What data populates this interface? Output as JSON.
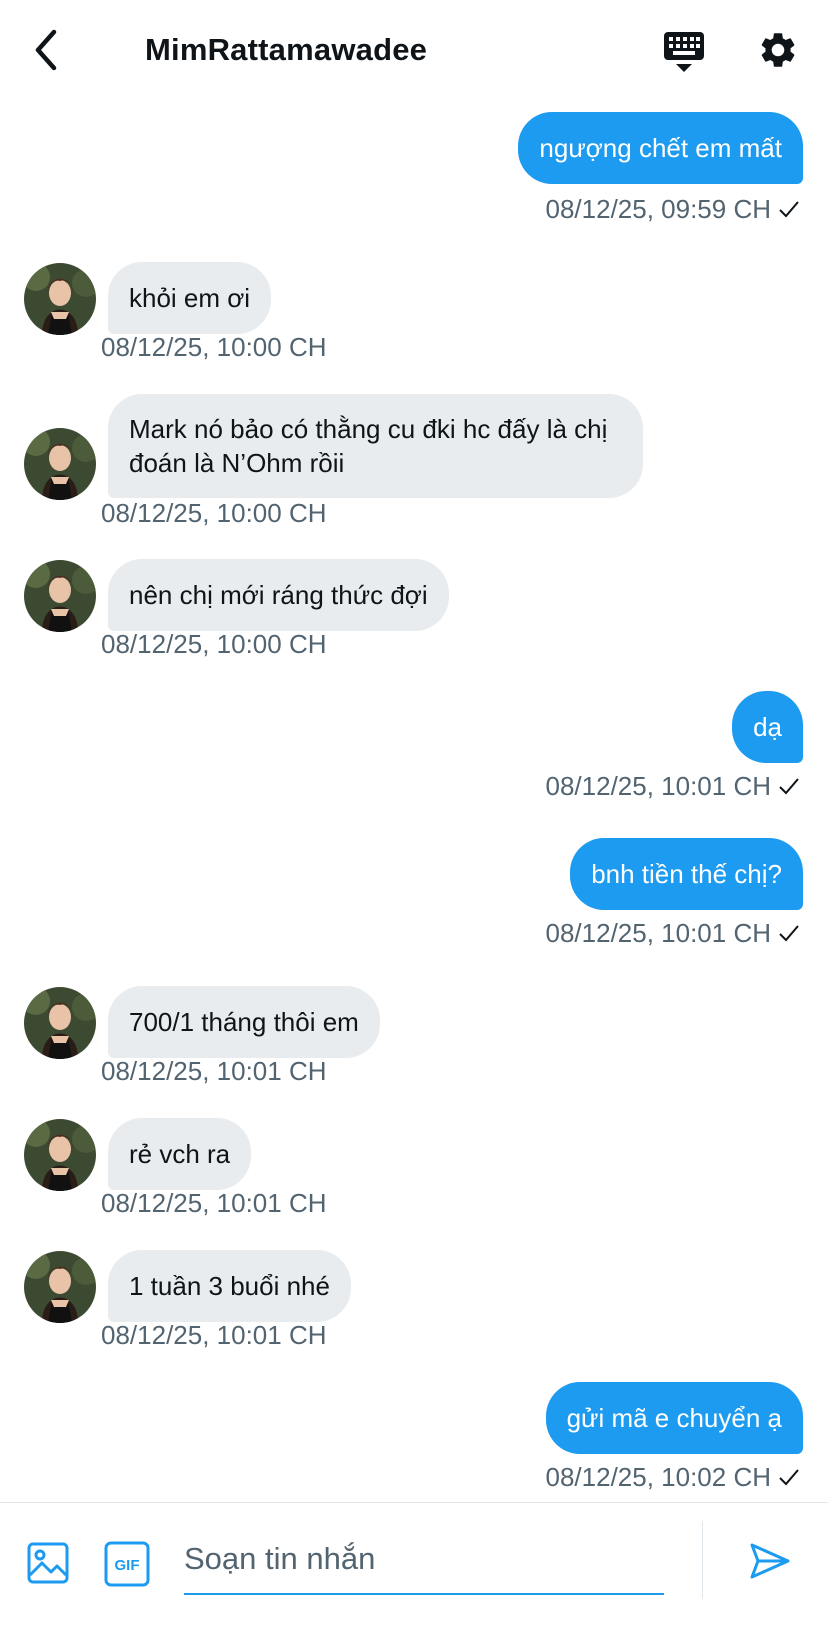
{
  "header": {
    "title": "MimRattamawadee",
    "icons": {
      "back": "back-arrow-icon",
      "keyboard": "keyboard-icon",
      "settings": "gear-icon"
    }
  },
  "messages": [
    {
      "direction": "out",
      "text": "ngượng chết em mất",
      "time": "08/12/25, 09:59 CH",
      "read": true
    },
    {
      "direction": "in",
      "text": "khỏi em ơi",
      "time": "08/12/25, 10:00 CH"
    },
    {
      "direction": "in",
      "text": "Mark nó bảo có thằng cu đki hc đấy là chị đoán là N’Ohm rồii",
      "time": "08/12/25, 10:00 CH"
    },
    {
      "direction": "in",
      "text": "nên chị mới ráng thức đợi",
      "time": "08/12/25, 10:00 CH"
    },
    {
      "direction": "out",
      "text": "dạ",
      "time": "08/12/25, 10:01 CH",
      "read": true
    },
    {
      "direction": "out",
      "text": "bnh tiền thế chị?",
      "time": "08/12/25, 10:01 CH",
      "read": true
    },
    {
      "direction": "in",
      "text": "700/1 tháng thôi em",
      "time": "08/12/25, 10:01 CH"
    },
    {
      "direction": "in",
      "text": "rẻ vch ra",
      "time": "08/12/25, 10:01 CH"
    },
    {
      "direction": "in",
      "text": "1 tuần 3 buổi nhé",
      "time": "08/12/25, 10:01 CH"
    },
    {
      "direction": "out",
      "text": "gửi mã e chuyển ạ",
      "time": "08/12/25, 10:02 CH",
      "read": true
    }
  ],
  "composer": {
    "placeholder": "Soạn tin nhắn",
    "value": "",
    "gif_label": "GIF",
    "icons": {
      "media": "image-icon",
      "gif": "gif-icon",
      "send": "send-icon"
    }
  },
  "colors": {
    "accent": "#1d9bf0",
    "incoming_bubble": "#e8ecef",
    "timestamp": "#536471",
    "text": "#0f1419"
  }
}
